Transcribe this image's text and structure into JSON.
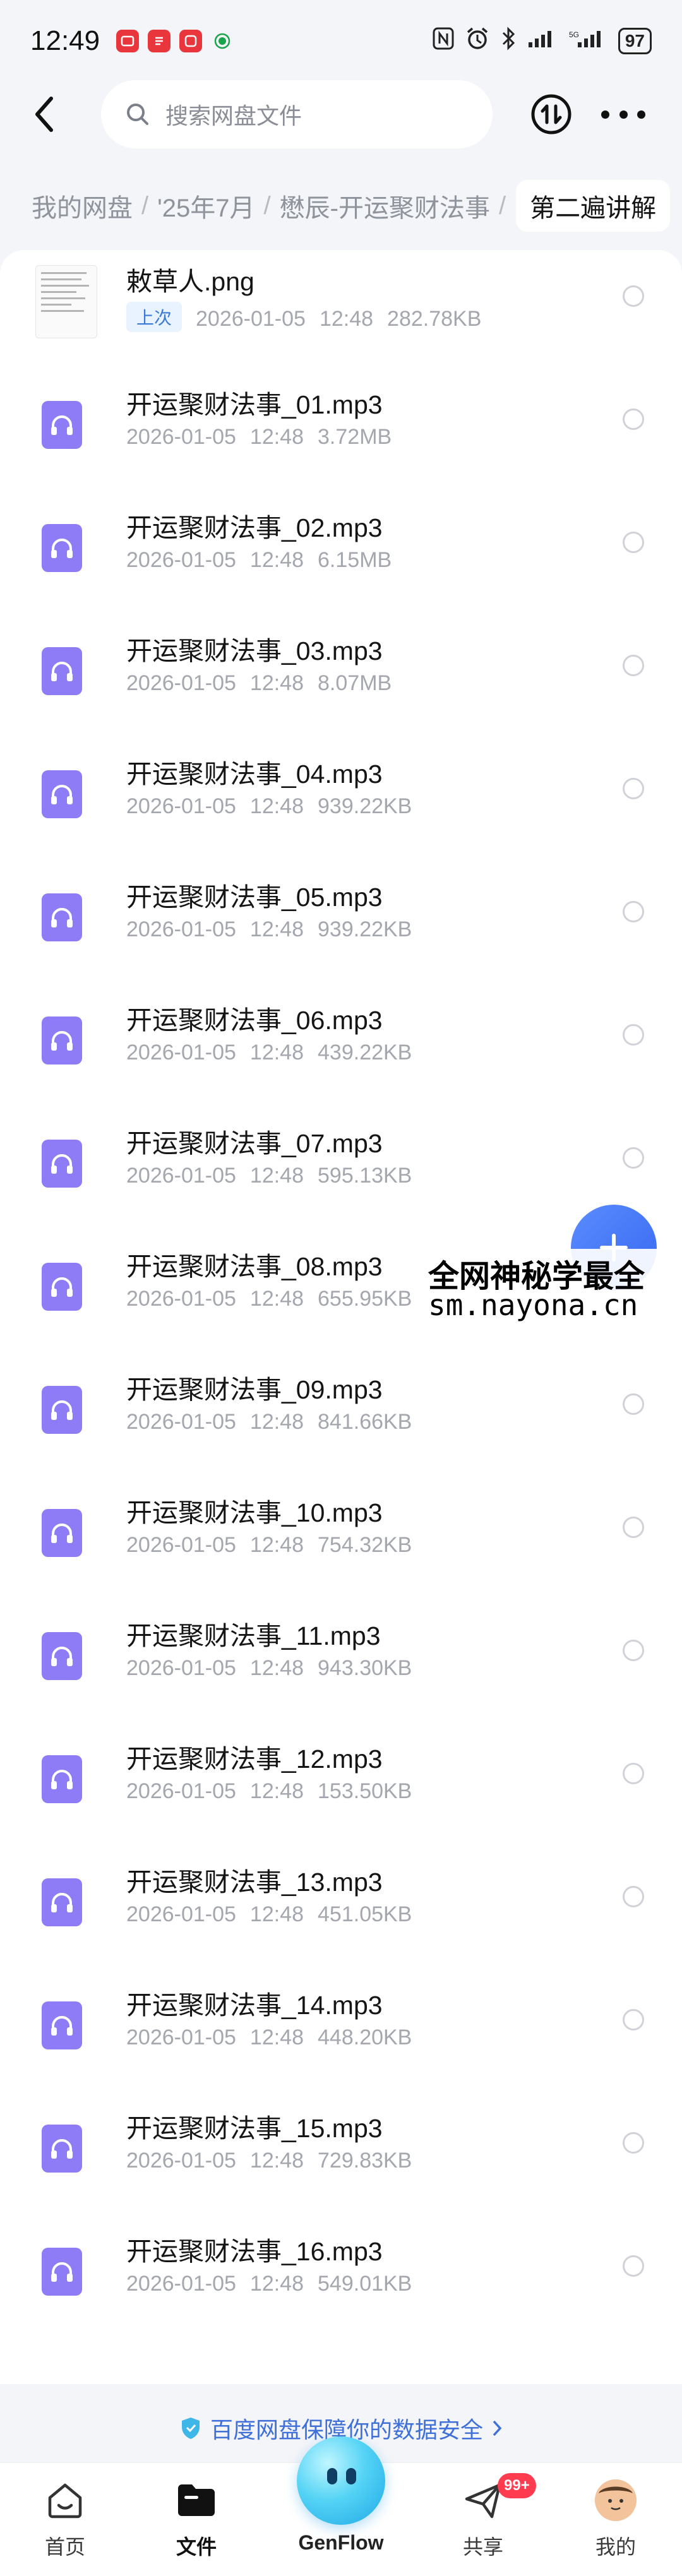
{
  "status_bar": {
    "time": "12:49",
    "battery": "97",
    "app_icons": [
      "news-app-icon",
      "video-app-icon",
      "shop-app-icon",
      "carrier-icon"
    ],
    "indicator_icons": [
      "nfc-icon",
      "alarm-icon",
      "bluetooth-icon",
      "signal-icon",
      "signal-icon",
      "battery-icon"
    ]
  },
  "top_bar": {
    "search_placeholder": "搜索网盘文件"
  },
  "breadcrumb": {
    "items": [
      "我的网盘",
      "'25年7月",
      "懋辰-开运聚财法事"
    ],
    "current": "第二遍讲解"
  },
  "files": [
    {
      "name": "敕草人.png",
      "type": "image",
      "tag": "上次",
      "date": "2026-01-05",
      "time": "12:48",
      "size": "282.78KB"
    },
    {
      "name": "开运聚财法事_01.mp3",
      "type": "audio",
      "date": "2026-01-05",
      "time": "12:48",
      "size": "3.72MB"
    },
    {
      "name": "开运聚财法事_02.mp3",
      "type": "audio",
      "date": "2026-01-05",
      "time": "12:48",
      "size": "6.15MB"
    },
    {
      "name": "开运聚财法事_03.mp3",
      "type": "audio",
      "date": "2026-01-05",
      "time": "12:48",
      "size": "8.07MB"
    },
    {
      "name": "开运聚财法事_04.mp3",
      "type": "audio",
      "date": "2026-01-05",
      "time": "12:48",
      "size": "939.22KB"
    },
    {
      "name": "开运聚财法事_05.mp3",
      "type": "audio",
      "date": "2026-01-05",
      "time": "12:48",
      "size": "939.22KB"
    },
    {
      "name": "开运聚财法事_06.mp3",
      "type": "audio",
      "date": "2026-01-05",
      "time": "12:48",
      "size": "439.22KB"
    },
    {
      "name": "开运聚财法事_07.mp3",
      "type": "audio",
      "date": "2026-01-05",
      "time": "12:48",
      "size": "595.13KB"
    },
    {
      "name": "开运聚财法事_08.mp3",
      "type": "audio",
      "date": "2026-01-05",
      "time": "12:48",
      "size": "655.95KB"
    },
    {
      "name": "开运聚财法事_09.mp3",
      "type": "audio",
      "date": "2026-01-05",
      "time": "12:48",
      "size": "841.66KB"
    },
    {
      "name": "开运聚财法事_10.mp3",
      "type": "audio",
      "date": "2026-01-05",
      "time": "12:48",
      "size": "754.32KB"
    },
    {
      "name": "开运聚财法事_11.mp3",
      "type": "audio",
      "date": "2026-01-05",
      "time": "12:48",
      "size": "943.30KB"
    },
    {
      "name": "开运聚财法事_12.mp3",
      "type": "audio",
      "date": "2026-01-05",
      "time": "12:48",
      "size": "153.50KB"
    },
    {
      "name": "开运聚财法事_13.mp3",
      "type": "audio",
      "date": "2026-01-05",
      "time": "12:48",
      "size": "451.05KB"
    },
    {
      "name": "开运聚财法事_14.mp3",
      "type": "audio",
      "date": "2026-01-05",
      "time": "12:48",
      "size": "448.20KB"
    },
    {
      "name": "开运聚财法事_15.mp3",
      "type": "audio",
      "date": "2026-01-05",
      "time": "12:48",
      "size": "729.83KB"
    },
    {
      "name": "开运聚财法事_16.mp3",
      "type": "audio",
      "date": "2026-01-05",
      "time": "12:48",
      "size": "549.01KB"
    }
  ],
  "watermark": {
    "line1": "全网神秘学最全",
    "line2": "sm.nayona.cn"
  },
  "security_banner": "百度网盘保障你的数据安全",
  "bottom_nav": {
    "items": [
      {
        "label": "首页",
        "icon": "home-icon"
      },
      {
        "label": "文件",
        "icon": "folder-icon"
      },
      {
        "label": "GenFlow",
        "icon": "genflow-icon"
      },
      {
        "label": "共享",
        "icon": "share-icon"
      },
      {
        "label": "我的",
        "icon": "avatar-icon"
      }
    ],
    "active": "文件",
    "share_badge": "99+"
  },
  "colors": {
    "accent": "#3f6fd8",
    "audio_icon": "#8e7cf6",
    "badge": "#ff3b4f"
  }
}
